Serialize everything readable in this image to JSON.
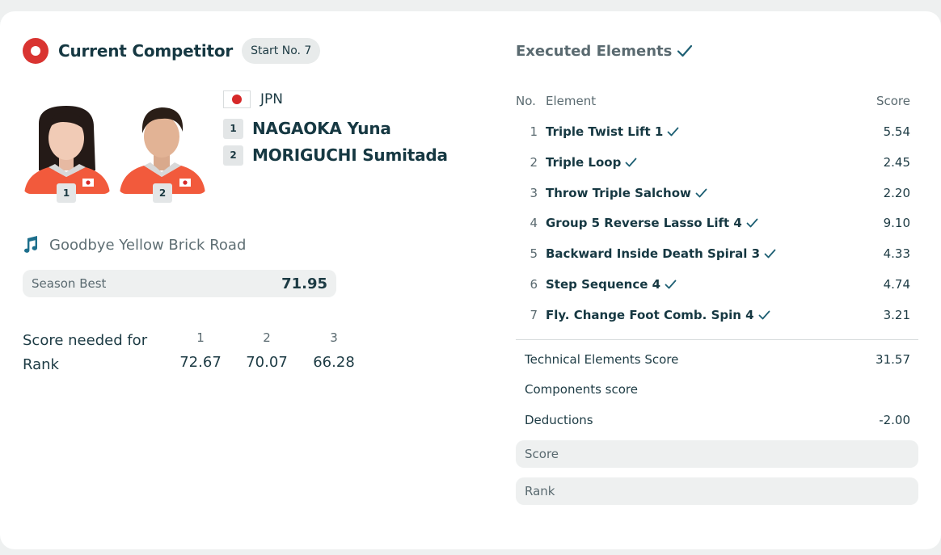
{
  "current": {
    "title": "Current Competitor",
    "start_badge": "Start No. 7",
    "nation": "JPN",
    "athletes": [
      {
        "num": "1",
        "name": "NAGAOKA Yuna"
      },
      {
        "num": "2",
        "name": "MORIGUCHI Sumitada"
      }
    ],
    "music_title": "Goodbye Yellow Brick Road",
    "season_best_label": "Season Best",
    "season_best_value": "71.95",
    "needed_label_1": "Score needed for",
    "needed_label_2": "Rank",
    "ranks": [
      {
        "rank": "1",
        "score": "72.67"
      },
      {
        "rank": "2",
        "score": "70.07"
      },
      {
        "rank": "3",
        "score": "66.28"
      }
    ]
  },
  "executed": {
    "title": "Executed Elements",
    "headers": {
      "no": "No.",
      "element": "Element",
      "score": "Score"
    },
    "elements": [
      {
        "no": "1",
        "name": "Triple Twist Lift 1",
        "score": "5.54"
      },
      {
        "no": "2",
        "name": "Triple Loop",
        "score": "2.45"
      },
      {
        "no": "3",
        "name": "Throw Triple Salchow",
        "score": "2.20"
      },
      {
        "no": "4",
        "name": "Group 5 Reverse Lasso Lift 4",
        "score": "9.10"
      },
      {
        "no": "5",
        "name": "Backward Inside Death Spiral 3",
        "score": "4.33"
      },
      {
        "no": "6",
        "name": "Step Sequence 4",
        "score": "4.74"
      },
      {
        "no": "7",
        "name": "Fly. Change Foot Comb. Spin 4",
        "score": "3.21"
      }
    ],
    "tes_label": "Technical Elements Score",
    "tes_value": "31.57",
    "components_label": "Components score",
    "components_value": "",
    "deductions_label": "Deductions",
    "deductions_value": "-2.00",
    "score_label": "Score",
    "rank_label": "Rank"
  },
  "colors": {
    "accent_red": "#d93431",
    "text_dark": "#163842",
    "text_muted": "#5a6a70",
    "pill_bg": "#eef0f0",
    "jersey": "#f25a3c"
  },
  "icons": {
    "record": "record-icon",
    "music": "music-note-icon",
    "check": "check-icon"
  }
}
